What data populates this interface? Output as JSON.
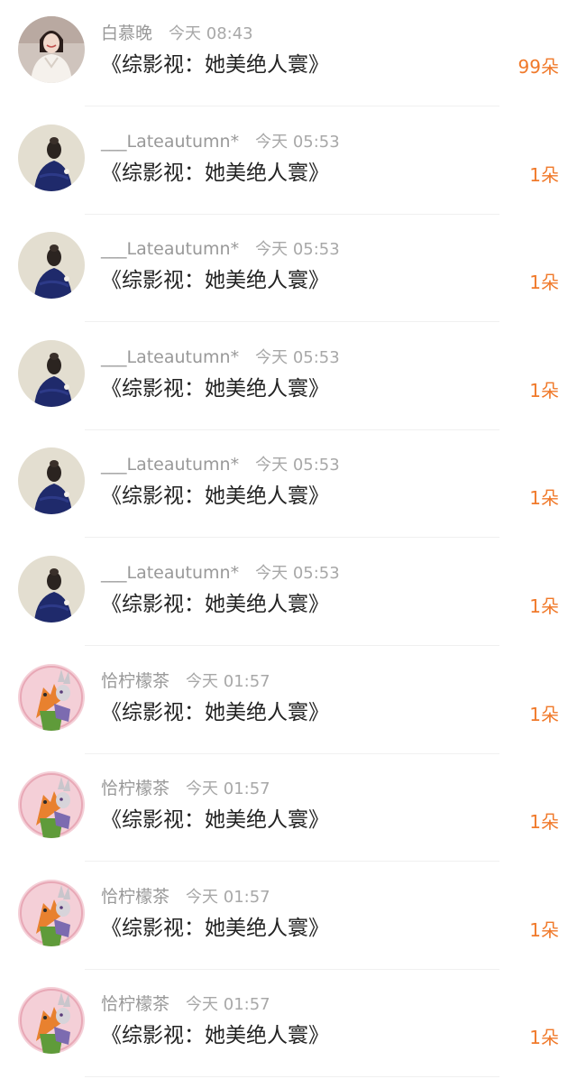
{
  "accent_color": "#f0792a",
  "items": [
    {
      "avatar": "portrait-white-dress",
      "name": "白慕晚",
      "time": "今天 08:43",
      "title": "《综影视：她美绝人寰》",
      "count": "99朵"
    },
    {
      "avatar": "portrait-blue-back",
      "name": "___Lateautumn*",
      "time": "今天 05:53",
      "title": "《综影视：她美绝人寰》",
      "count": "1朵"
    },
    {
      "avatar": "portrait-blue-back",
      "name": "___Lateautumn*",
      "time": "今天 05:53",
      "title": "《综影视：她美绝人寰》",
      "count": "1朵"
    },
    {
      "avatar": "portrait-blue-back",
      "name": "___Lateautumn*",
      "time": "今天 05:53",
      "title": "《综影视：她美绝人寰》",
      "count": "1朵"
    },
    {
      "avatar": "portrait-blue-back",
      "name": "___Lateautumn*",
      "time": "今天 05:53",
      "title": "《综影视：她美绝人寰》",
      "count": "1朵"
    },
    {
      "avatar": "portrait-blue-back",
      "name": "___Lateautumn*",
      "time": "今天 05:53",
      "title": "《综影视：她美绝人寰》",
      "count": "1朵"
    },
    {
      "avatar": "cartoon-fox-bunny",
      "name": "恰柠檬茶",
      "time": "今天 01:57",
      "title": "《综影视：她美绝人寰》",
      "count": "1朵"
    },
    {
      "avatar": "cartoon-fox-bunny",
      "name": "恰柠檬茶",
      "time": "今天 01:57",
      "title": "《综影视：她美绝人寰》",
      "count": "1朵"
    },
    {
      "avatar": "cartoon-fox-bunny",
      "name": "恰柠檬茶",
      "time": "今天 01:57",
      "title": "《综影视：她美绝人寰》",
      "count": "1朵"
    },
    {
      "avatar": "cartoon-fox-bunny",
      "name": "恰柠檬茶",
      "time": "今天 01:57",
      "title": "《综影视：她美绝人寰》",
      "count": "1朵"
    }
  ]
}
